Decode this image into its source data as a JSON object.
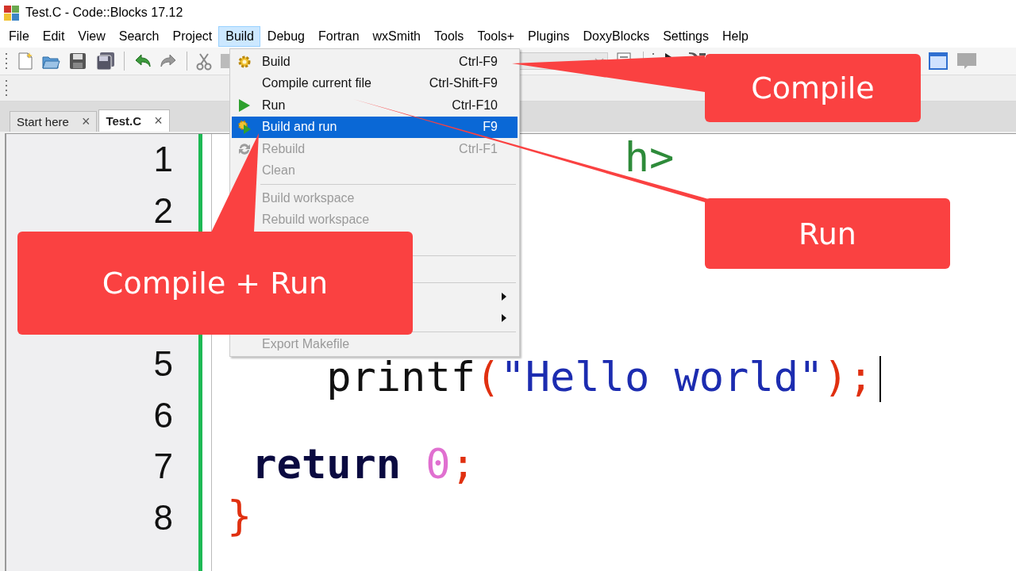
{
  "window": {
    "title": "Test.C - Code::Blocks 17.12"
  },
  "menu_bar": [
    {
      "label": "File",
      "selected": false
    },
    {
      "label": "Edit",
      "selected": false
    },
    {
      "label": "View",
      "selected": false
    },
    {
      "label": "Search",
      "selected": false
    },
    {
      "label": "Project",
      "selected": false
    },
    {
      "label": "Build",
      "selected": true
    },
    {
      "label": "Debug",
      "selected": false
    },
    {
      "label": "Fortran",
      "selected": false
    },
    {
      "label": "wxSmith",
      "selected": false
    },
    {
      "label": "Tools",
      "selected": false
    },
    {
      "label": "Tools+",
      "selected": false
    },
    {
      "label": "Plugins",
      "selected": false
    },
    {
      "label": "DoxyBlocks",
      "selected": false
    },
    {
      "label": "Settings",
      "selected": false
    },
    {
      "label": "Help",
      "selected": false
    }
  ],
  "tabs": [
    {
      "label": "Start here",
      "selected": false,
      "close": "×"
    },
    {
      "label": "Test.C",
      "selected": true,
      "close": "×"
    }
  ],
  "editor": {
    "lines": [
      {
        "kind": "line",
        "number": "1",
        "tokens": [
          {
            "kind": "preprocessor",
            "text": "h>"
          }
        ]
      },
      {
        "kind": "line",
        "number": "2"
      },
      {
        "kind": "hidden"
      },
      {
        "kind": "hidden"
      },
      {
        "kind": "line",
        "number": "5",
        "cursor": true,
        "tokens": [
          {
            "kind": "plain",
            "text": "printf"
          },
          {
            "kind": "operator",
            "text": "("
          },
          {
            "kind": "string",
            "text": "\"Hello world\""
          },
          {
            "kind": "operator",
            "text": ");"
          }
        ]
      },
      {
        "kind": "line",
        "number": "6"
      },
      {
        "kind": "line",
        "number": "7",
        "tokens": [
          {
            "kind": "keyword",
            "text": "return"
          },
          {
            "kind": "number",
            "text": "0"
          },
          {
            "kind": "operator",
            "text": ";"
          }
        ]
      },
      {
        "kind": "line",
        "number": "8",
        "tokens": [
          {
            "kind": "operator",
            "text": "}"
          }
        ]
      }
    ]
  },
  "build_menu": {
    "items": [
      {
        "kind": "item",
        "label": "Build",
        "shortcut": "Ctrl-F9",
        "selected": false,
        "disabled": false
      },
      {
        "kind": "item",
        "label": "Compile current file",
        "shortcut": "Ctrl-Shift-F9",
        "selected": false,
        "disabled": false
      },
      {
        "kind": "item",
        "label": "Run",
        "shortcut": "Ctrl-F10",
        "selected": false,
        "disabled": false
      },
      {
        "kind": "item",
        "label": "Build and run",
        "shortcut": "F9",
        "selected": true,
        "disabled": false
      },
      {
        "kind": "item",
        "label": "Rebuild",
        "shortcut": "Ctrl-F1",
        "selected": false,
        "disabled": true
      },
      {
        "kind": "item",
        "label": "Clean",
        "selected": false,
        "disabled": true
      },
      {
        "kind": "separator"
      },
      {
        "kind": "item",
        "label": "Build workspace",
        "selected": false,
        "disabled": true
      },
      {
        "kind": "item",
        "label": "Rebuild workspace",
        "selected": false,
        "disabled": true
      },
      {
        "kind": "hidden"
      },
      {
        "kind": "separator"
      },
      {
        "kind": "hidden"
      },
      {
        "kind": "separator"
      },
      {
        "kind": "submenu"
      },
      {
        "kind": "submenu"
      },
      {
        "kind": "separator"
      },
      {
        "kind": "item",
        "label": "Export Makefile",
        "selected": false,
        "disabled": true
      }
    ]
  },
  "callouts": [
    {
      "label": "Compile"
    },
    {
      "label": "Run"
    },
    {
      "label": "Compile + Run"
    }
  ]
}
